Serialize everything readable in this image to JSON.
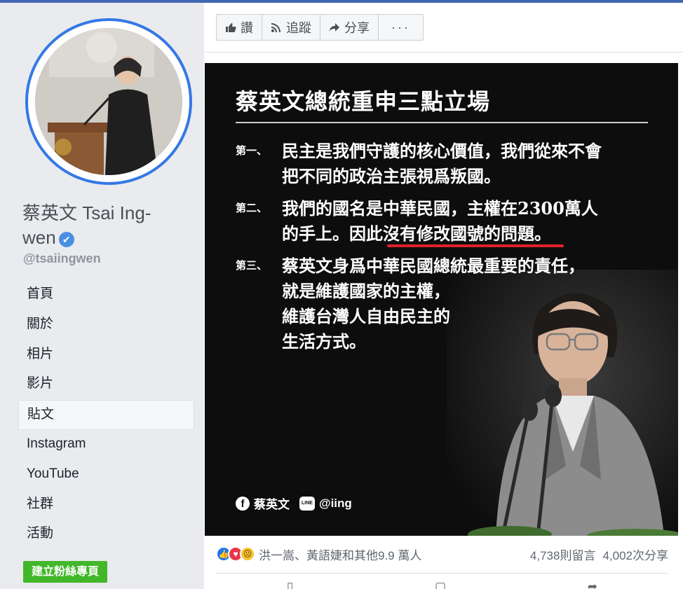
{
  "profile": {
    "name": "蔡英文 Tsai Ing-wen",
    "handle": "@tsaiingwen"
  },
  "nav": {
    "items": [
      {
        "label": "首頁"
      },
      {
        "label": "關於"
      },
      {
        "label": "相片"
      },
      {
        "label": "影片"
      },
      {
        "label": "貼文"
      },
      {
        "label": "Instagram"
      },
      {
        "label": "YouTube"
      },
      {
        "label": "社群"
      },
      {
        "label": "活動"
      }
    ],
    "active": "貼文"
  },
  "create_page_button": "建立粉絲專頁",
  "actionbar": {
    "like": "讚",
    "follow": "追蹤",
    "share": "分享",
    "more": "···"
  },
  "post_image": {
    "title": "蔡英文總統重申三點立場",
    "points": [
      {
        "label": "第一、",
        "lines": [
          "民主是我們守護的核心價值，我們從來不會",
          "把不同的政治主張視爲叛國。"
        ]
      },
      {
        "label": "第二、",
        "lines": [
          "我們的國名是中華民國，主權在2300萬人",
          "的手上。因此沒有修改國號的問題。"
        ]
      },
      {
        "label": "第三、",
        "lines": [
          "蔡英文身爲中華民國總統最重要的責任，",
          "就是維護國家的主權，",
          "維護台灣人自由民主的",
          "生活方式。"
        ]
      }
    ],
    "footer_fb": "蔡英文",
    "footer_line": "@iing"
  },
  "reactions": {
    "summary": "洪一嵩、黃語婕和其他9.9 萬人",
    "comments": "4,738則留言",
    "shares": "4,002次分享"
  },
  "colors": {
    "accent": "#4267b2",
    "ring": "#3578e5",
    "create_button": "#42b72a",
    "highlight_underline": "#e0202a"
  }
}
